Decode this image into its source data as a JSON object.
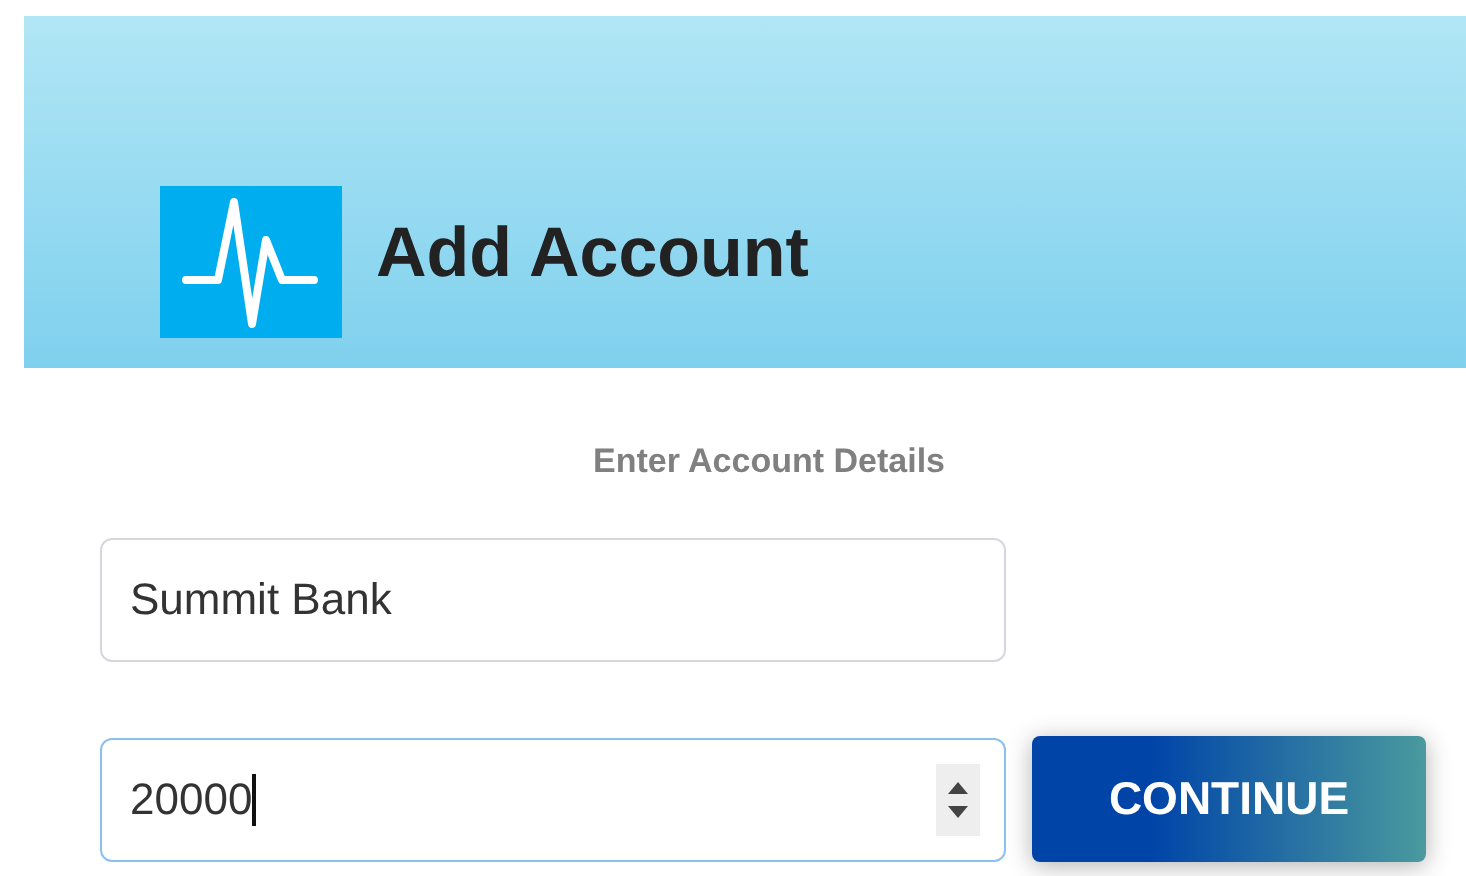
{
  "header": {
    "title": "Add Account"
  },
  "form": {
    "heading": "Enter Account Details",
    "fields": [
      {
        "kind": "text",
        "value": "Summit Bank",
        "focused": false
      },
      {
        "kind": "number",
        "value": "20000",
        "focused": true
      }
    ],
    "button": "CONTINUE"
  }
}
